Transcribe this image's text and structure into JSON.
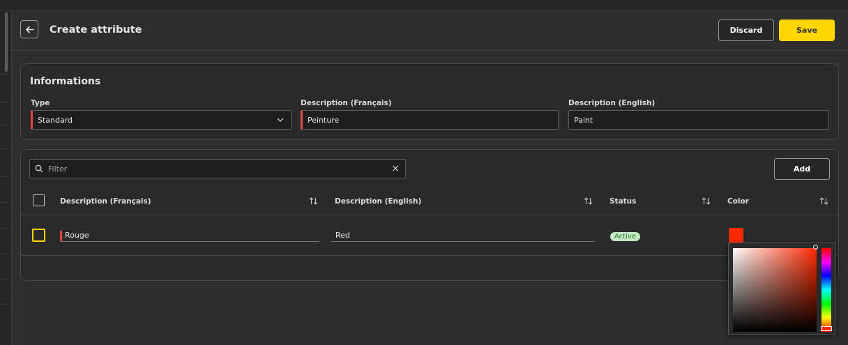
{
  "header": {
    "title": "Create attribute",
    "discard_label": "Discard",
    "save_label": "Save"
  },
  "informations": {
    "title": "Informations",
    "type": {
      "label": "Type",
      "value": "Standard"
    },
    "desc_fr": {
      "label": "Description (Français)",
      "value": "Peinture"
    },
    "desc_en": {
      "label": "Description (English)",
      "value": "Paint"
    }
  },
  "values_table": {
    "filter": {
      "placeholder": "Filter"
    },
    "add_label": "Add",
    "columns": [
      "Description (Français)",
      "Description (English)",
      "Status",
      "Color"
    ],
    "rows": [
      {
        "desc_fr": "Rouge",
        "desc_en": "Red",
        "status": "Active",
        "color": "#ff2a00"
      }
    ]
  },
  "colors": {
    "accent": "#ffd600",
    "required": "#e04646",
    "active_badge_bg": "#c3e8c4",
    "active_badge_text": "#2e7d32"
  },
  "icons": [
    "arrow-left-icon",
    "chevron-down-icon",
    "search-icon",
    "close-icon",
    "sort-icon"
  ]
}
